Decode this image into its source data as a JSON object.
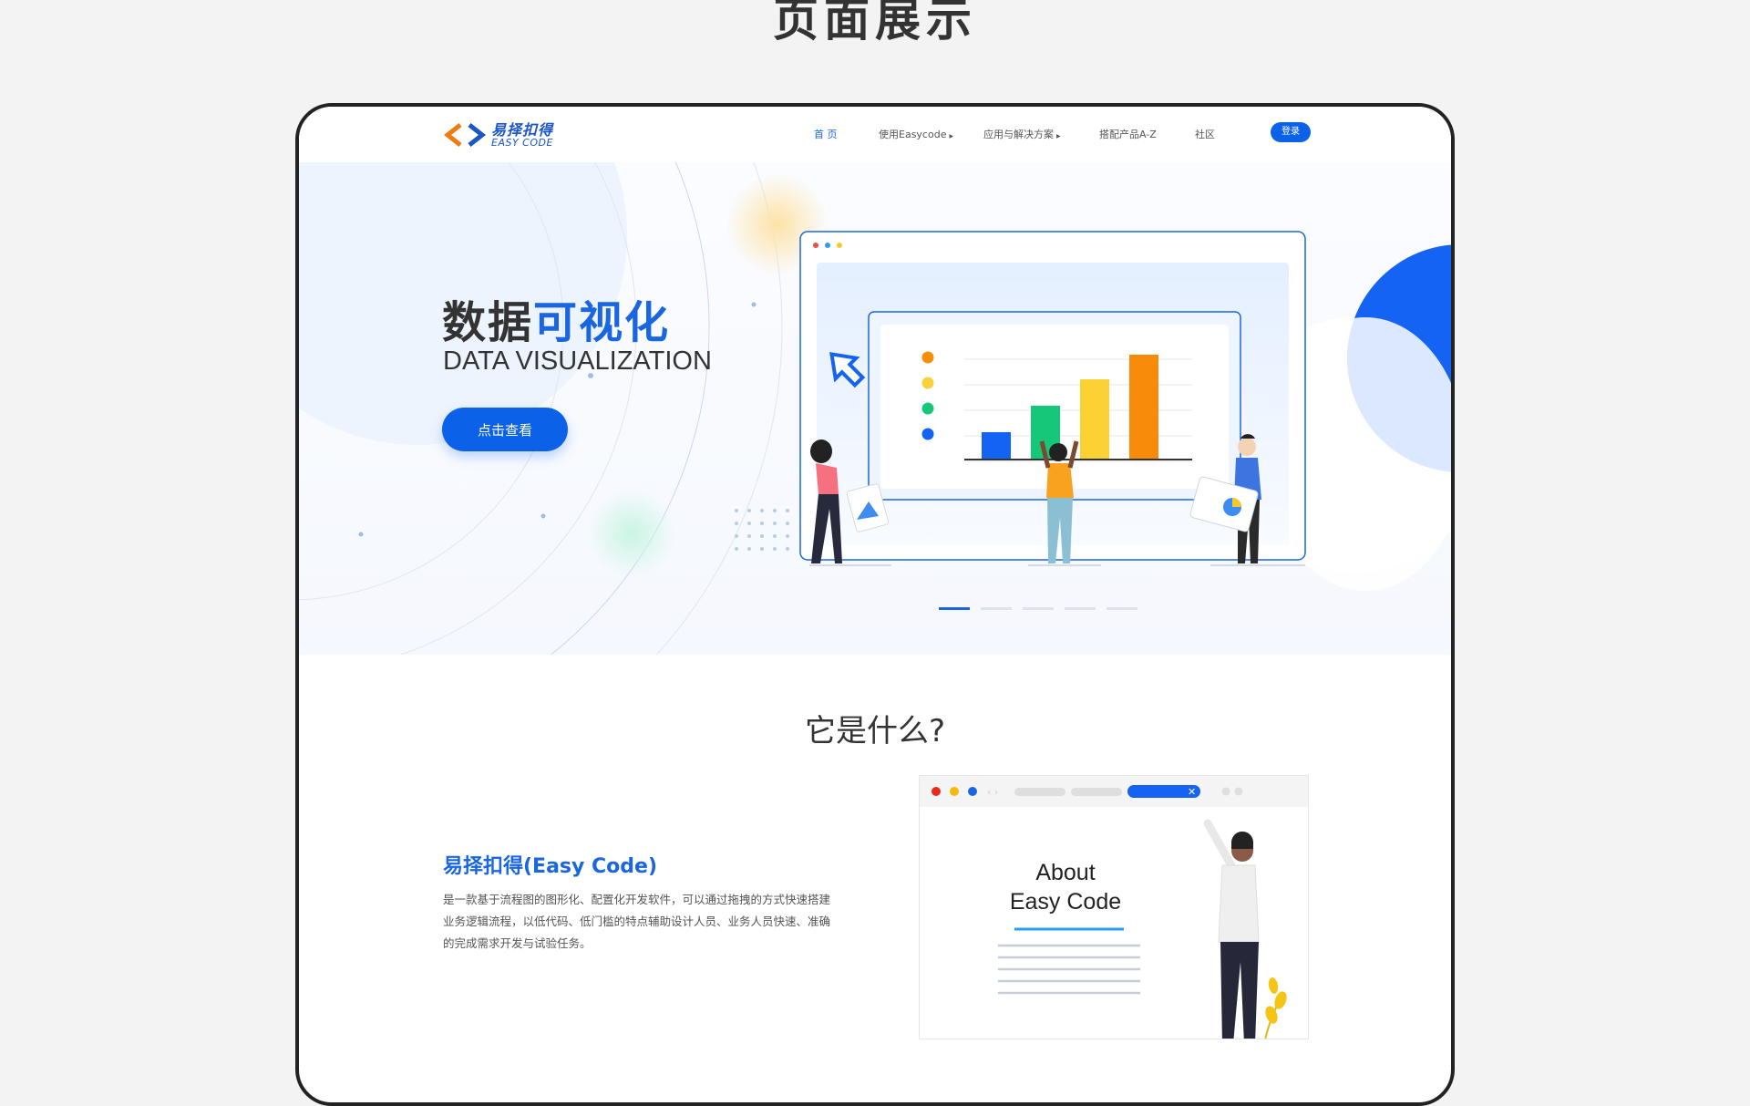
{
  "page_heading": "页面展示",
  "logo": {
    "cn": "易择扣得",
    "en": "EASY CODE"
  },
  "nav": {
    "items": [
      {
        "label": "首 页",
        "active": true,
        "caret": false
      },
      {
        "label": "使用Easycode",
        "active": false,
        "caret": true
      },
      {
        "label": "应用与解决方案",
        "active": false,
        "caret": true
      },
      {
        "label": "搭配产品A-Z",
        "active": false,
        "caret": false
      },
      {
        "label": "社区",
        "active": false,
        "caret": false
      }
    ],
    "login": "登录"
  },
  "hero": {
    "title_dark": "数据",
    "title_highlight": "可视化",
    "subtitle": "DATA VISUALIZATION",
    "cta": "点击查看",
    "slides": 5,
    "active_slide": 1
  },
  "section": {
    "title": "它是什么?",
    "about_heading": "易择扣得(Easy Code)",
    "about_text": "是一款基于流程图的图形化、配置化开发软件，可以通过拖拽的方式快速搭建业务逻辑流程，以低代码、低门槛的特点辅助设计人员、业务人员快速、准确的完成需求开发与试验任务。",
    "card_title_line1": "About",
    "card_title_line2": "Easy Code"
  },
  "colors": {
    "brand": "#0b62e8",
    "accent_orange": "#ef7a12"
  }
}
